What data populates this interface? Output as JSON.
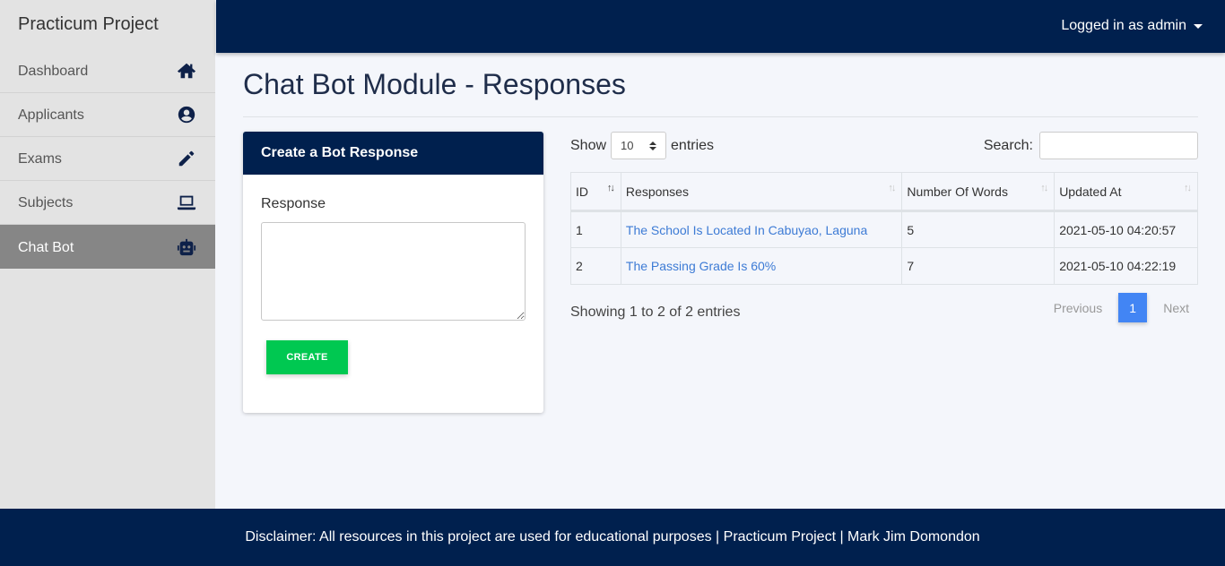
{
  "app": {
    "brand": "Practicum Project"
  },
  "sidebar": {
    "items": [
      {
        "label": "Dashboard",
        "icon": "home-icon"
      },
      {
        "label": "Applicants",
        "icon": "user-circle-icon"
      },
      {
        "label": "Exams",
        "icon": "pencil-icon"
      },
      {
        "label": "Subjects",
        "icon": "laptop-icon"
      },
      {
        "label": "Chat Bot",
        "icon": "robot-icon",
        "active": true
      }
    ]
  },
  "header": {
    "user_label": "Logged in as admin"
  },
  "page": {
    "title": "Chat Bot Module - Responses"
  },
  "form": {
    "title": "Create a Bot Response",
    "field_label": "Response",
    "field_value": "",
    "button_label": "CREATE"
  },
  "table": {
    "show_label": "Show",
    "entries_value": "10",
    "entries_label": "entries",
    "search_label": "Search:",
    "search_value": "",
    "columns": [
      "ID",
      "Responses",
      "Number Of Words",
      "Updated At"
    ],
    "rows": [
      {
        "id": "1",
        "response": "The School Is Located In Cabuyao, Laguna",
        "words": "5",
        "updated": "2021-05-10 04:20:57"
      },
      {
        "id": "2",
        "response": "The Passing Grade Is 60%",
        "words": "7",
        "updated": "2021-05-10 04:22:19"
      }
    ],
    "info": "Showing 1 to 2 of 2 entries",
    "pagination": {
      "previous": "Previous",
      "current": "1",
      "next": "Next"
    }
  },
  "footer": {
    "text": "Disclaimer: All resources in this project are used for educational purposes | Practicum Project | Mark Jim Domondon"
  },
  "colors": {
    "navy": "#00204e",
    "success": "#00c851",
    "primary": "#4285f4",
    "link": "#3d7bd5"
  }
}
